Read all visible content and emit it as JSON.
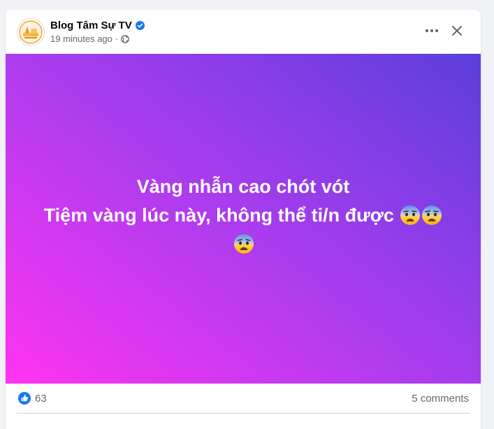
{
  "post": {
    "author": "Blog Tâm Sự TV",
    "verified": true,
    "timestamp": "19 minutes ago",
    "separator": "·",
    "privacy_icon": "globe-icon",
    "text_line1": "Vàng nhẫn cao chót vót",
    "text_line2": "Tiệm vàng lúc này, không thể ti/n được",
    "emoji": "anxious-face-with-sweat",
    "emoji_count": 3,
    "background_gradient": [
      "#ff33f1",
      "#b13cef",
      "#8a3de8",
      "#5b3fd9"
    ]
  },
  "header_actions": {
    "more_icon": "more-options-icon",
    "close_icon": "close-icon"
  },
  "footer": {
    "reaction_icon": "like-icon",
    "reaction_count": "63",
    "comments_label": "5 comments"
  },
  "colors": {
    "accent": "#1877f2",
    "text_primary": "#050505",
    "text_secondary": "#65676b"
  }
}
